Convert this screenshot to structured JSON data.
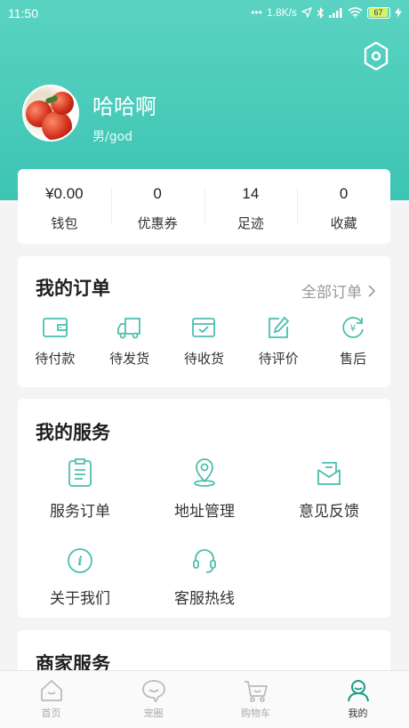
{
  "status_bar": {
    "time": "11:50",
    "network_speed": "1.8K/s",
    "battery": "67"
  },
  "profile": {
    "name": "哈哈啊",
    "subtitle": "男/god"
  },
  "stats": [
    {
      "value": "¥0.00",
      "label": "钱包"
    },
    {
      "value": "0",
      "label": "优惠券"
    },
    {
      "value": "14",
      "label": "足迹"
    },
    {
      "value": "0",
      "label": "收藏"
    }
  ],
  "orders": {
    "title": "我的订单",
    "all_label": "全部订单",
    "items": [
      {
        "icon": "wallet-icon",
        "label": "待付款"
      },
      {
        "icon": "truck-icon",
        "label": "待发货"
      },
      {
        "icon": "box-icon",
        "label": "待收货"
      },
      {
        "icon": "edit-icon",
        "label": "待评价"
      },
      {
        "icon": "refund-icon",
        "label": "售后"
      }
    ]
  },
  "services": {
    "title": "我的服务",
    "items": [
      {
        "icon": "clipboard-icon",
        "label": "服务订单"
      },
      {
        "icon": "location-icon",
        "label": "地址管理"
      },
      {
        "icon": "mail-icon",
        "label": "意见反馈"
      },
      {
        "icon": "info-icon",
        "label": "关于我们"
      },
      {
        "icon": "headset-icon",
        "label": "客服热线"
      }
    ]
  },
  "merchant": {
    "title": "商家服务"
  },
  "tabs": [
    {
      "icon": "home-icon",
      "label": "首页",
      "active": false
    },
    {
      "icon": "chat-icon",
      "label": "宠圈",
      "active": false
    },
    {
      "icon": "cart-icon",
      "label": "购物车",
      "active": false
    },
    {
      "icon": "profile-icon",
      "label": "我的",
      "active": true
    }
  ],
  "colors": {
    "accent": "#3fc6b4",
    "icon_teal": "#4cbfae",
    "tab_active": "#1c9a85"
  }
}
